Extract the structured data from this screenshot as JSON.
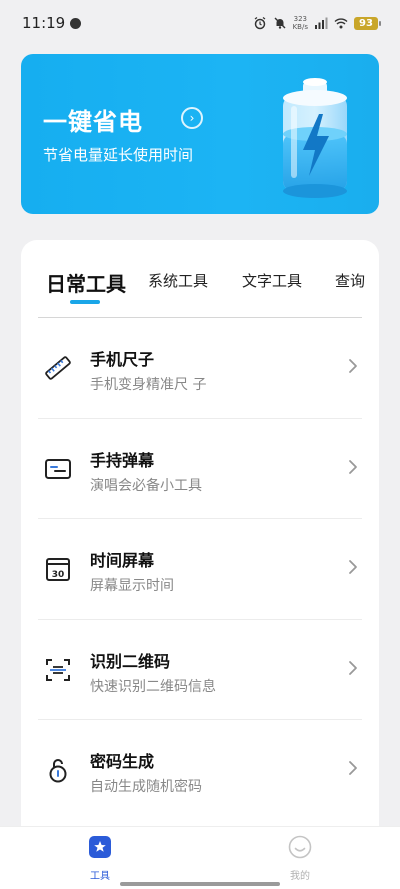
{
  "status_bar": {
    "time": "11:19",
    "net_speed_value": "323",
    "net_speed_unit": "KB/s",
    "battery": "93"
  },
  "banner": {
    "title": "一键省电",
    "subtitle": "节省电量延长使用时间",
    "arrow_glyph": "›",
    "background_color": "#1cb4f4"
  },
  "tabs": [
    {
      "label": "日常工具",
      "active": true
    },
    {
      "label": "系统工具",
      "active": false
    },
    {
      "label": "文字工具",
      "active": false
    },
    {
      "label": "查询",
      "active": false
    }
  ],
  "tools": [
    {
      "title": "手机尺子",
      "subtitle": "手机变身精准尺 子",
      "icon": "ruler-icon"
    },
    {
      "title": "手持弹幕",
      "subtitle": "演唱会必备小工具",
      "icon": "barrage-icon"
    },
    {
      "title": "时间屏幕",
      "subtitle": "屏幕显示时间",
      "icon": "calendar-icon"
    },
    {
      "title": "识别二维码",
      "subtitle": "快速识别二维码信息",
      "icon": "scan-icon"
    },
    {
      "title": "密码生成",
      "subtitle": "自动生成随机密码",
      "icon": "lock-icon"
    }
  ],
  "bottom_nav": [
    {
      "label": "工具",
      "icon": "toolbox-star-icon",
      "active": true
    },
    {
      "label": "我的",
      "icon": "smiley-icon",
      "active": false
    }
  ],
  "colors": {
    "accent": "#1aa6e8",
    "nav_active": "#2b5bd8",
    "nav_inactive": "#b0b0b0"
  }
}
